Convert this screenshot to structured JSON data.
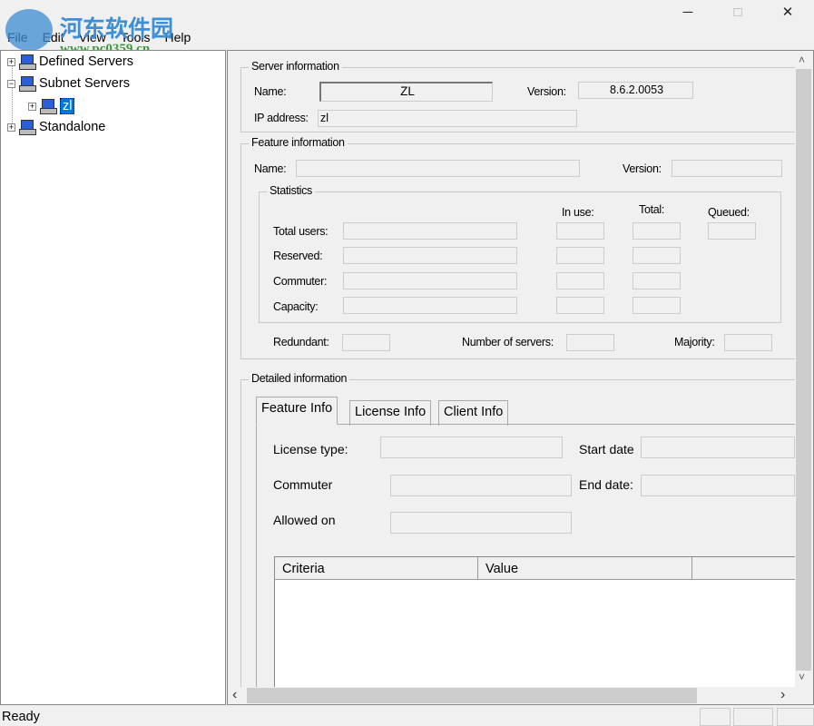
{
  "window": {
    "minimize": "─",
    "maximize": "□",
    "close": "✕"
  },
  "watermark": {
    "text": "河东软件园",
    "url": "www.pc0359.cn"
  },
  "menu": [
    "File",
    "Edit",
    "View",
    "Tools",
    "Help"
  ],
  "tree": {
    "items": [
      {
        "label": "Defined Servers",
        "expander": "+"
      },
      {
        "label": "Subnet Servers",
        "expander": "−"
      },
      {
        "label": "zl",
        "expander": "+"
      },
      {
        "label": "Standalone",
        "expander": "+"
      }
    ]
  },
  "server_info": {
    "legend": "Server information",
    "name_label": "Name:",
    "name_value": "ZL",
    "version_label": "Version:",
    "version_value": "8.6.2.0053",
    "ip_label": "IP address:",
    "ip_value": "zl"
  },
  "feature_info": {
    "legend": "Feature information",
    "name_label": "Name:",
    "version_label": "Version:",
    "statistics": {
      "legend": "Statistics",
      "col_in_use": "In use:",
      "col_total": "Total:",
      "col_queued": "Queued:",
      "rows": [
        "Total users:",
        "Reserved:",
        "Commuter:",
        "Capacity:"
      ]
    },
    "redundant_label": "Redundant:",
    "num_servers_label": "Number of servers:",
    "majority_label": "Majority:"
  },
  "detailed": {
    "legend": "Detailed information",
    "tabs": [
      "Feature Info",
      "License Info",
      "Client Info"
    ],
    "active_tab": 0,
    "license_type": "License type:",
    "start_date": "Start date",
    "commuter": "Commuter",
    "end_date": "End date:",
    "allowed_on": "Allowed on",
    "table_columns": [
      "Criteria",
      "Value",
      ""
    ]
  },
  "scroll": {
    "up": "˄",
    "down": "˅",
    "left": "‹",
    "right": "›"
  },
  "status": {
    "text": "Ready"
  }
}
